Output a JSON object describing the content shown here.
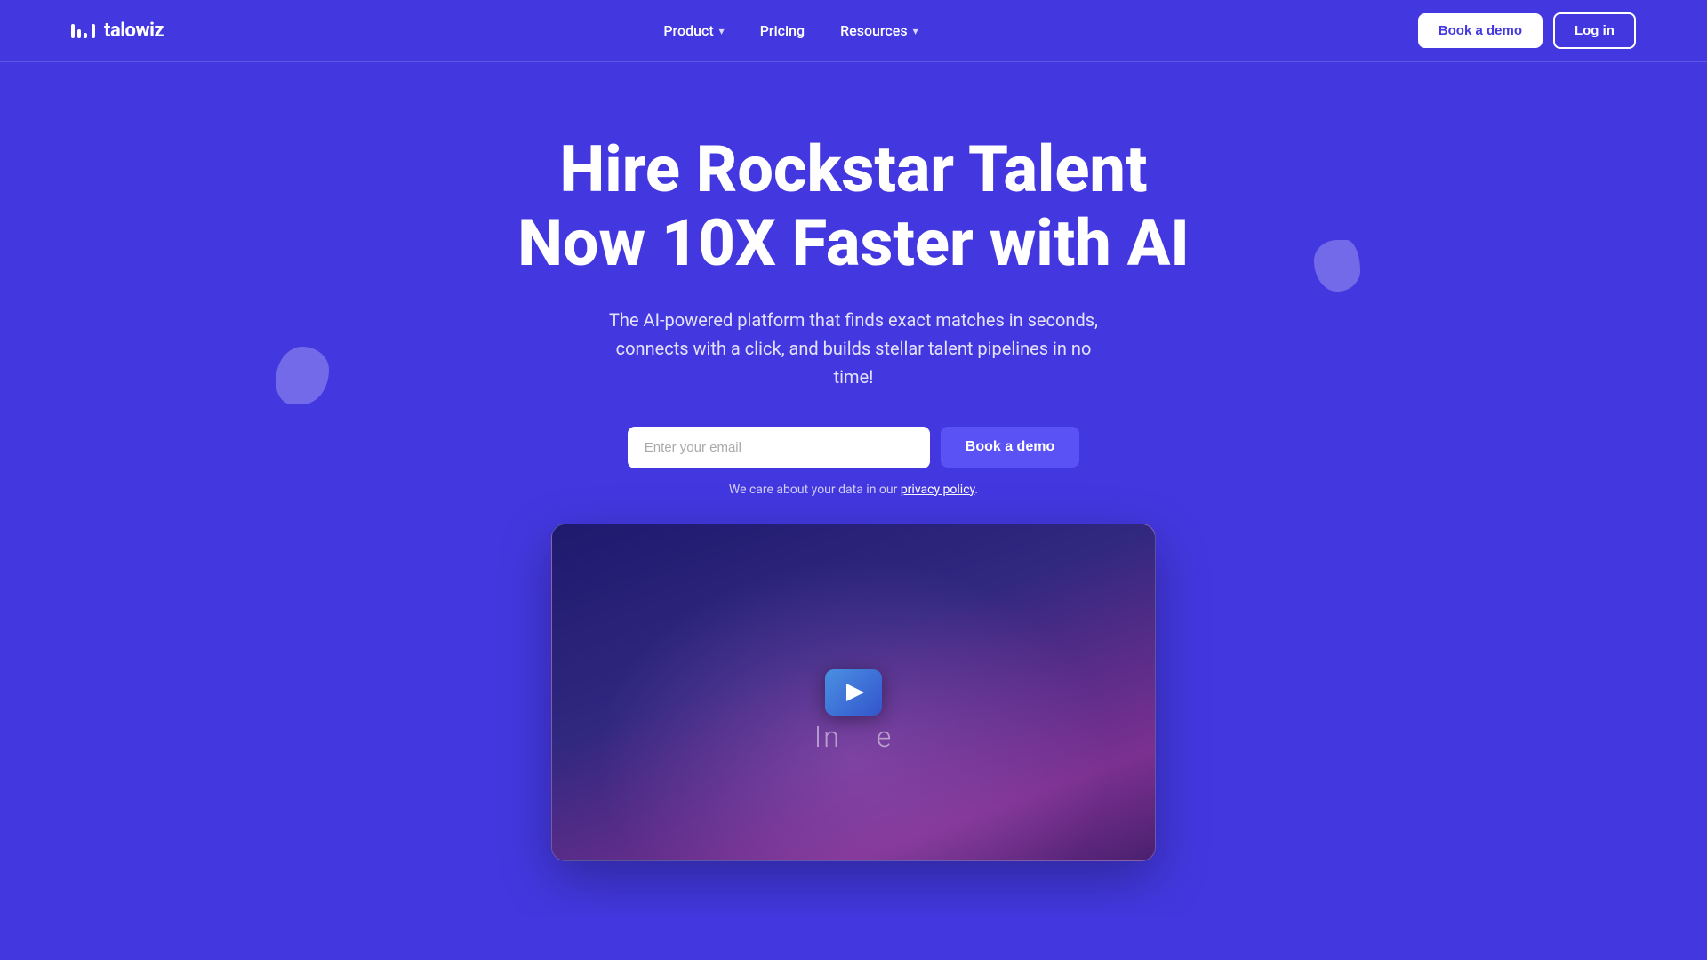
{
  "brand": {
    "name": "talowiz",
    "logo_bars": [
      {
        "width": 4,
        "height": 16
      },
      {
        "width": 4,
        "height": 12
      },
      {
        "width": 4,
        "height": 8
      },
      {
        "width": 4,
        "height": 16
      }
    ]
  },
  "nav": {
    "items": [
      {
        "label": "Product",
        "has_dropdown": true
      },
      {
        "label": "Pricing",
        "has_dropdown": false
      },
      {
        "label": "Resources",
        "has_dropdown": true
      }
    ],
    "cta_book": "Book a demo",
    "cta_login": "Log in"
  },
  "hero": {
    "headline_line1": "Hire Rockstar Talent",
    "headline_line2": "Now 10X Faster with AI",
    "subtitle": "The AI-powered platform that finds exact matches in seconds, connects with a click, and builds stellar talent pipelines in no time!",
    "email_placeholder": "Enter your email",
    "cta_label": "Book a demo",
    "privacy_text": "We care about your data in our ",
    "privacy_link": "privacy policy",
    "privacy_period": "."
  },
  "video": {
    "overlay_text": "In▶e"
  },
  "colors": {
    "bg": "#4338e0",
    "nav_border": "rgba(255,255,255,0.15)",
    "btn_book_bg": "#ffffff",
    "btn_login_border": "#ffffff"
  }
}
